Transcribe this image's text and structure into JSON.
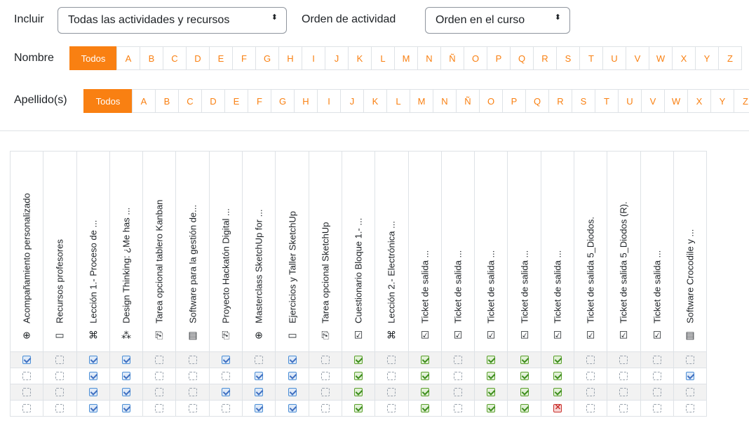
{
  "filters": {
    "incluir_label": "Incluir",
    "incluir_value": "Todas las actividades y recursos",
    "orden_label": "Orden de actividad",
    "orden_value": "Orden en el curso",
    "caret": "⬍"
  },
  "nombre": {
    "label": "Nombre",
    "letters": [
      "Todos",
      "A",
      "B",
      "C",
      "D",
      "E",
      "F",
      "G",
      "H",
      "I",
      "J",
      "K",
      "L",
      "M",
      "N",
      "Ñ",
      "O",
      "P",
      "Q",
      "R",
      "S",
      "T",
      "U",
      "V",
      "W",
      "X",
      "Y",
      "Z"
    ]
  },
  "apellido": {
    "label": "Apellido(s)",
    "letters": [
      "Todos",
      "A",
      "B",
      "C",
      "D",
      "E",
      "F",
      "G",
      "H",
      "I",
      "J",
      "K",
      "L",
      "M",
      "N",
      "Ñ",
      "O",
      "P",
      "Q",
      "R",
      "S",
      "T",
      "U",
      "V",
      "W",
      "X",
      "Y",
      "Z"
    ]
  },
  "columns": [
    {
      "name": "Acompañamiento personalizado",
      "icon": "⊕"
    },
    {
      "name": "Recursos profesores",
      "icon": "▭"
    },
    {
      "name": "Lección 1.- Proceso de ...",
      "icon": "⌘"
    },
    {
      "name": "Design Thinking: ¿Me has ...",
      "icon": "⁂"
    },
    {
      "name": "Tarea opcional tablero Kanban",
      "icon": "⎘"
    },
    {
      "name": "Software para la gestión de...",
      "icon": "▤"
    },
    {
      "name": "Proyecto Hackatón Digital ...",
      "icon": "⎘"
    },
    {
      "name": "Masterclass SketchUp for ...",
      "icon": "⊕"
    },
    {
      "name": "Ejercicios y Taller SketchUp",
      "icon": "▭"
    },
    {
      "name": "Tarea opcional SketchUp",
      "icon": "⎘"
    },
    {
      "name": "Cuestionario Bloque 1.- ...",
      "icon": "☑"
    },
    {
      "name": "Lección 2.- Electrónica ...",
      "icon": "⌘"
    },
    {
      "name": "Ticket de salida ...",
      "icon": "☑"
    },
    {
      "name": "Ticket de salida ...",
      "icon": "☑"
    },
    {
      "name": "Ticket de salida ...",
      "icon": "☑"
    },
    {
      "name": "Ticket de salida ...",
      "icon": "☑"
    },
    {
      "name": "Ticket de salida ...",
      "icon": "☑"
    },
    {
      "name": "Ticket de salida 5_Diodos.",
      "icon": "☑"
    },
    {
      "name": "Ticket de salida 5_Diodos (R).",
      "icon": "☑"
    },
    {
      "name": "Ticket de salida ...",
      "icon": "☑"
    },
    {
      "name": "Software Crocodile y ...",
      "icon": "▤"
    }
  ],
  "rows": [
    [
      "b",
      "e",
      "b",
      "b",
      "e",
      "e",
      "b",
      "e",
      "b",
      "e",
      "g",
      "e",
      "g",
      "e",
      "g",
      "g",
      "g",
      "e",
      "e",
      "e",
      "e"
    ],
    [
      "e",
      "e",
      "b",
      "b",
      "e",
      "e",
      "e",
      "b",
      "b",
      "e",
      "g",
      "e",
      "g",
      "e",
      "g",
      "g",
      "g",
      "e",
      "e",
      "e",
      "b"
    ],
    [
      "e",
      "e",
      "b",
      "b",
      "e",
      "e",
      "b",
      "b",
      "b",
      "e",
      "g",
      "e",
      "g",
      "e",
      "g",
      "g",
      "g",
      "e",
      "e",
      "e",
      "e"
    ],
    [
      "e",
      "e",
      "b",
      "b",
      "e",
      "e",
      "e",
      "b",
      "b",
      "e",
      "g",
      "e",
      "g",
      "e",
      "g",
      "g",
      "x",
      "e",
      "e",
      "e",
      "e"
    ]
  ]
}
